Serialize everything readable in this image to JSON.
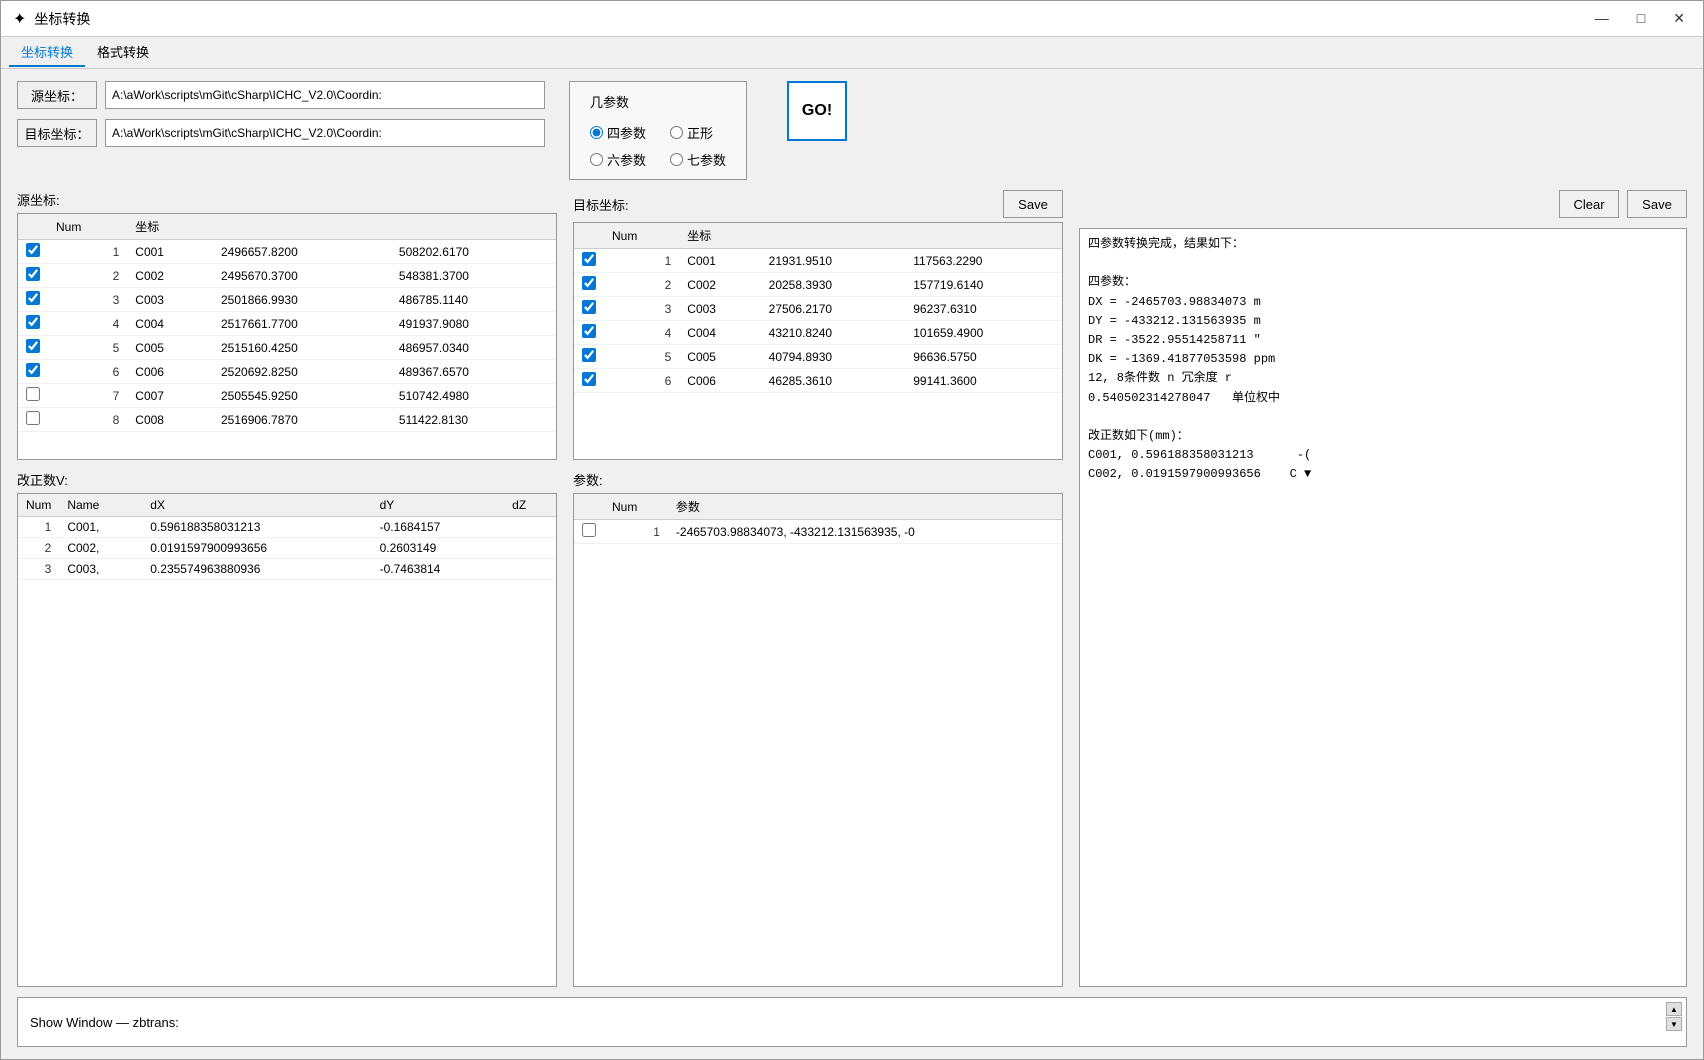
{
  "window": {
    "title": "坐标转换",
    "icon": "✦",
    "controls": {
      "minimize": "—",
      "maximize": "□",
      "close": "✕"
    }
  },
  "menu": {
    "items": [
      {
        "label": "坐标转换",
        "active": true
      },
      {
        "label": "格式转换",
        "active": false
      }
    ]
  },
  "source_file": {
    "label": "源坐标：",
    "value": "A:\\aWork\\scripts\\mGit\\cSharp\\ICHC_V2.0\\Coordin:"
  },
  "target_file": {
    "label": "目标坐标：",
    "value": "A:\\aWork\\scripts\\mGit\\cSharp\\ICHC_V2.0\\Coordin:"
  },
  "params": {
    "title": "几参数",
    "options": [
      {
        "label": "四参数",
        "checked": true
      },
      {
        "label": "正形",
        "checked": false
      },
      {
        "label": "六参数",
        "checked": false
      },
      {
        "label": "七参数",
        "checked": false
      }
    ]
  },
  "go_button": "GO!",
  "source_coords": {
    "label": "源坐标:",
    "columns": [
      "Num",
      "坐标"
    ],
    "rows": [
      {
        "checked": true,
        "num": "1",
        "name": "C001",
        "x": "2496657.8200",
        "y": "508202.6170"
      },
      {
        "checked": true,
        "num": "2",
        "name": "C002",
        "x": "2495670.3700",
        "y": "548381.3700"
      },
      {
        "checked": true,
        "num": "3",
        "name": "C003",
        "x": "2501866.9930",
        "y": "486785.1140"
      },
      {
        "checked": true,
        "num": "4",
        "name": "C004",
        "x": "2517661.7700",
        "y": "491937.9080"
      },
      {
        "checked": true,
        "num": "5",
        "name": "C005",
        "x": "2515160.4250",
        "y": "486957.0340"
      },
      {
        "checked": true,
        "num": "6",
        "name": "C006",
        "x": "2520692.8250",
        "y": "489367.6570"
      },
      {
        "checked": false,
        "num": "7",
        "name": "C007",
        "x": "2505545.9250",
        "y": "510742.4980"
      },
      {
        "checked": false,
        "num": "8",
        "name": "C008",
        "x": "2516906.7870",
        "y": "511422.8130"
      }
    ]
  },
  "target_coords": {
    "label": "目标坐标:",
    "save_label": "Save",
    "columns": [
      "Num",
      "坐标"
    ],
    "rows": [
      {
        "checked": true,
        "num": "1",
        "name": "C001",
        "x": "21931.9510",
        "y": "117563.2290"
      },
      {
        "checked": true,
        "num": "2",
        "name": "C002",
        "x": "20258.3930",
        "y": "157719.6140"
      },
      {
        "checked": true,
        "num": "3",
        "name": "C003",
        "x": "27506.2170",
        "y": "96237.6310"
      },
      {
        "checked": true,
        "num": "4",
        "name": "C004",
        "x": "43210.8240",
        "y": "101659.4900"
      },
      {
        "checked": true,
        "num": "5",
        "name": "C005",
        "x": "40794.8930",
        "y": "96636.5750"
      },
      {
        "checked": true,
        "num": "6",
        "name": "C006",
        "x": "46285.3610",
        "y": "99141.3600"
      }
    ]
  },
  "corrections": {
    "label": "改正数V:",
    "columns": [
      "Num",
      "Name",
      "dX",
      "dY",
      "dZ"
    ],
    "rows": [
      {
        "num": "1",
        "name": "C001,",
        "dx": "0.596188358031213",
        "dy": "-0.1684157",
        "dz": ""
      },
      {
        "num": "2",
        "name": "C002,",
        "dx": "0.019159790099365​6",
        "dy": "0.2603149",
        "dz": ""
      },
      {
        "num": "3",
        "name": "C003,",
        "dx": "0.235574963880936",
        "dy": "-0.7463814",
        "dz": ""
      }
    ]
  },
  "parameters": {
    "label": "参数:",
    "columns": [
      "Num",
      "参数"
    ],
    "rows": [
      {
        "checked": false,
        "num": "1",
        "value": "-2465703.98834073, -433212.131563935, -0"
      }
    ]
  },
  "result_panel": {
    "clear_label": "Clear",
    "save_label": "Save",
    "content": "四参数转换完成，结果如下：\n\n四参数：\nDX = -2465703.98834073 m\nDY = -433212.131563935 m\nDR = -3522.95514258711 \"\nDK = -1369.41877053598 ppm\n12, 8条件数 n 冗余度 r\n0.540502314278047   单位权中\n\n改正数如下(mm)：\nC001, 0.596188358031213      -(\nC002, 0.0191597900993656    C ▼"
  },
  "status_bar": {
    "text": "Show Window — zbtrans:"
  }
}
